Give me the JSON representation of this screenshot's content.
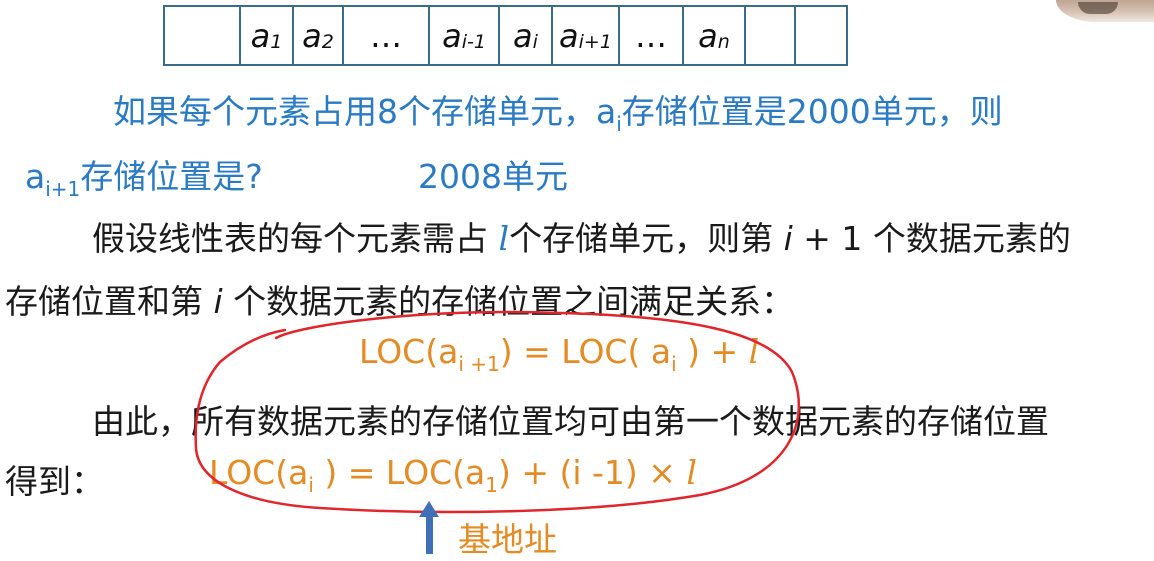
{
  "table": {
    "cells": [
      {
        "base": "",
        "sub": ""
      },
      {
        "base": "a",
        "sub": "1"
      },
      {
        "base": "a",
        "sub": "2"
      },
      {
        "base": "…",
        "sub": ""
      },
      {
        "base": "a",
        "sub": "i-1"
      },
      {
        "base": "a",
        "sub": "i"
      },
      {
        "base": "a",
        "sub": "i+1"
      },
      {
        "base": "…",
        "sub": ""
      },
      {
        "base": "a",
        "sub": "n"
      },
      {
        "base": "",
        "sub": ""
      },
      {
        "base": "",
        "sub": ""
      }
    ]
  },
  "question": {
    "line1_pre": "如果每个元素占用8个存储单元，a",
    "line1_sub": "i",
    "line1_post": "存储位置是2000单元，则",
    "line2_a": "a",
    "line2_sub": "i+1",
    "line2_post": "存储位置是?",
    "answer": "2008单元"
  },
  "para1": {
    "l1_pre": "假设线性表的每个元素需占 ",
    "l1_var": "l",
    "l1_mid": "个存储单元，则第 ",
    "l1_i": "i",
    "l1_post": " + 1 个数据元素的",
    "l2_pre": "存储位置和第 ",
    "l2_i": "i",
    "l2_post": " 个数据元素的存储位置之间满足关系："
  },
  "formula1": {
    "pre": "LOC(a",
    "sub": "i +1",
    "mid": ") = LOC( a",
    "sub2": "i",
    "post": " ) + ",
    "var": "l"
  },
  "para2": {
    "l1": "由此，所有数据元素的存储位置均可由第一个数据元素的存储位置",
    "l2": "得到："
  },
  "formula2": {
    "pre": "LOC(a",
    "sub": "i",
    "mid": " ) = LOC(a",
    "sub2": "1",
    "post": ") + (i -1) × ",
    "var": "l"
  },
  "annotation": {
    "label": "基地址",
    "arrow_icon": "up-arrow-icon"
  },
  "colors": {
    "blue_text": "#2a7ac4",
    "orange_formula": "#e38b25",
    "red_ink": "#e0252b",
    "table_border": "#3a6b8c",
    "arrow": "#3f6fb6"
  }
}
